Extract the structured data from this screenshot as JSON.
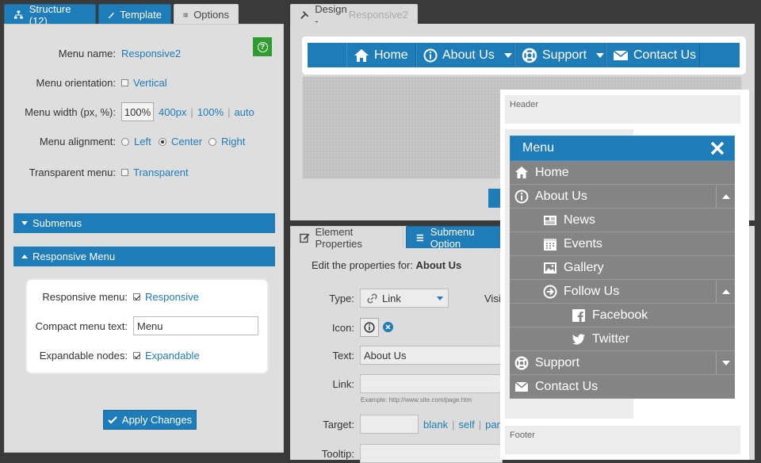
{
  "tabs": {
    "structure": "Structure (12)",
    "template": "Template",
    "options": "Options",
    "design_prefix": "Design - ",
    "design_name": "Responsive2",
    "element_properties": "Element Properties",
    "submenu_options": "Submenu Option"
  },
  "options": {
    "menu_name_label": "Menu name:",
    "menu_name_value": "Responsive2",
    "help_label": "?",
    "orientation_label": "Menu orientation:",
    "orientation_option": "Vertical",
    "width_label": "Menu width (px, %):",
    "width_value": "100%",
    "width_presets": [
      "400px",
      "100%",
      "auto"
    ],
    "alignment_label": "Menu alignment:",
    "alignment_options": [
      "Left",
      "Center",
      "Right"
    ],
    "alignment_selected": "Center",
    "transparent_label": "Transparent menu:",
    "transparent_option": "Transparent",
    "submenus_section": "Submenus",
    "responsive_section": "Responsive Menu",
    "responsive_label": "Responsive menu:",
    "responsive_option": "Responsive",
    "compact_label": "Compact menu text:",
    "compact_value": "Menu",
    "expandable_label": "Expandable nodes:",
    "expandable_option": "Expandable",
    "apply_button": "Apply Changes"
  },
  "design": {
    "menu_items": [
      "Home",
      "About Us",
      "Support",
      "Contact Us"
    ]
  },
  "element": {
    "edit_prefix": "Edit the properties for: ",
    "edit_item": "About Us",
    "type_label": "Type:",
    "type_value": "Link",
    "visibility_partial": "Visi",
    "icon_label": "Icon:",
    "text_label": "Text:",
    "text_value": "About Us",
    "link_label": "Link:",
    "link_hint": "Example: http://www.site.com/page.htm",
    "target_label": "Target:",
    "target_presets": [
      "blank",
      "self",
      "pare"
    ],
    "tooltip_label": "Tooltip:"
  },
  "preview": {
    "header": "Header",
    "footer": "Footer",
    "menu_title": "Menu",
    "items": [
      {
        "label": "Home",
        "icon": "home-icon",
        "level": 0,
        "toggle": ""
      },
      {
        "label": "About Us",
        "icon": "info-icon",
        "level": 0,
        "toggle": "up"
      },
      {
        "label": "News",
        "icon": "newspaper-icon",
        "level": 1,
        "toggle": ""
      },
      {
        "label": "Events",
        "icon": "calendar-icon",
        "level": 1,
        "toggle": ""
      },
      {
        "label": "Gallery",
        "icon": "image-icon",
        "level": 1,
        "toggle": ""
      },
      {
        "label": "Follow Us",
        "icon": "arrow-circle-icon",
        "level": 1,
        "toggle": "up"
      },
      {
        "label": "Facebook",
        "icon": "facebook-icon",
        "level": 2,
        "toggle": ""
      },
      {
        "label": "Twitter",
        "icon": "twitter-icon",
        "level": 2,
        "toggle": ""
      },
      {
        "label": "Support",
        "icon": "lifebuoy-icon",
        "level": 0,
        "toggle": "down"
      },
      {
        "label": "Contact Us",
        "icon": "envelope-icon",
        "level": 0,
        "toggle": ""
      }
    ]
  },
  "colors": {
    "accent": "#1e7cb8",
    "help_green": "#2e9d2e",
    "menu_item_gray": "#848484"
  }
}
